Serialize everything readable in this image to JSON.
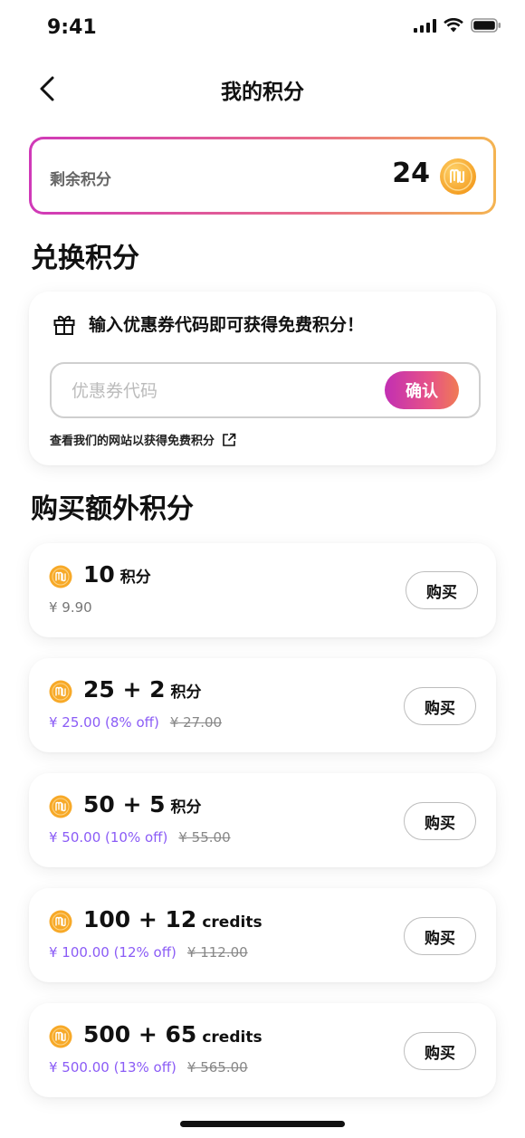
{
  "status": {
    "time": "9:41"
  },
  "nav": {
    "title": "我的积分"
  },
  "balance": {
    "label": "剩余积分",
    "value": "24"
  },
  "redeem": {
    "section_title": "兑换积分",
    "heading": "输入优惠券代码即可获得免费积分！",
    "placeholder": "优惠券代码",
    "confirm_label": "确认",
    "website_link": "查看我们的网站以获得免费积分"
  },
  "purchase": {
    "section_title": "购买额外积分",
    "buy_label": "购买",
    "packs": [
      {
        "amount": "10",
        "unit": "积分",
        "price": "¥ 9.90",
        "original": ""
      },
      {
        "amount": "25 + 2",
        "unit": "积分",
        "price": "¥ 25.00 (8% off)",
        "original": "¥ 27.00"
      },
      {
        "amount": "50 + 5",
        "unit": "积分",
        "price": "¥ 50.00 (10% off)",
        "original": "¥ 55.00"
      },
      {
        "amount": "100 + 12",
        "unit": "credits",
        "price": "¥ 100.00 (12% off)",
        "original": "¥ 112.00"
      },
      {
        "amount": "500 + 65",
        "unit": "credits",
        "price": "¥ 500.00 (13% off)",
        "original": "¥ 565.00"
      }
    ]
  },
  "colors": {
    "accent_gradient_start": "#c22fb3",
    "accent_gradient_end": "#f07b54",
    "discount_price": "#8b5cf6",
    "coin_gold": "#f7a928"
  },
  "icons": {
    "back": "chevron-left-icon",
    "gift": "gift-icon",
    "external_link": "external-link-icon",
    "coin": "coin-icon"
  }
}
